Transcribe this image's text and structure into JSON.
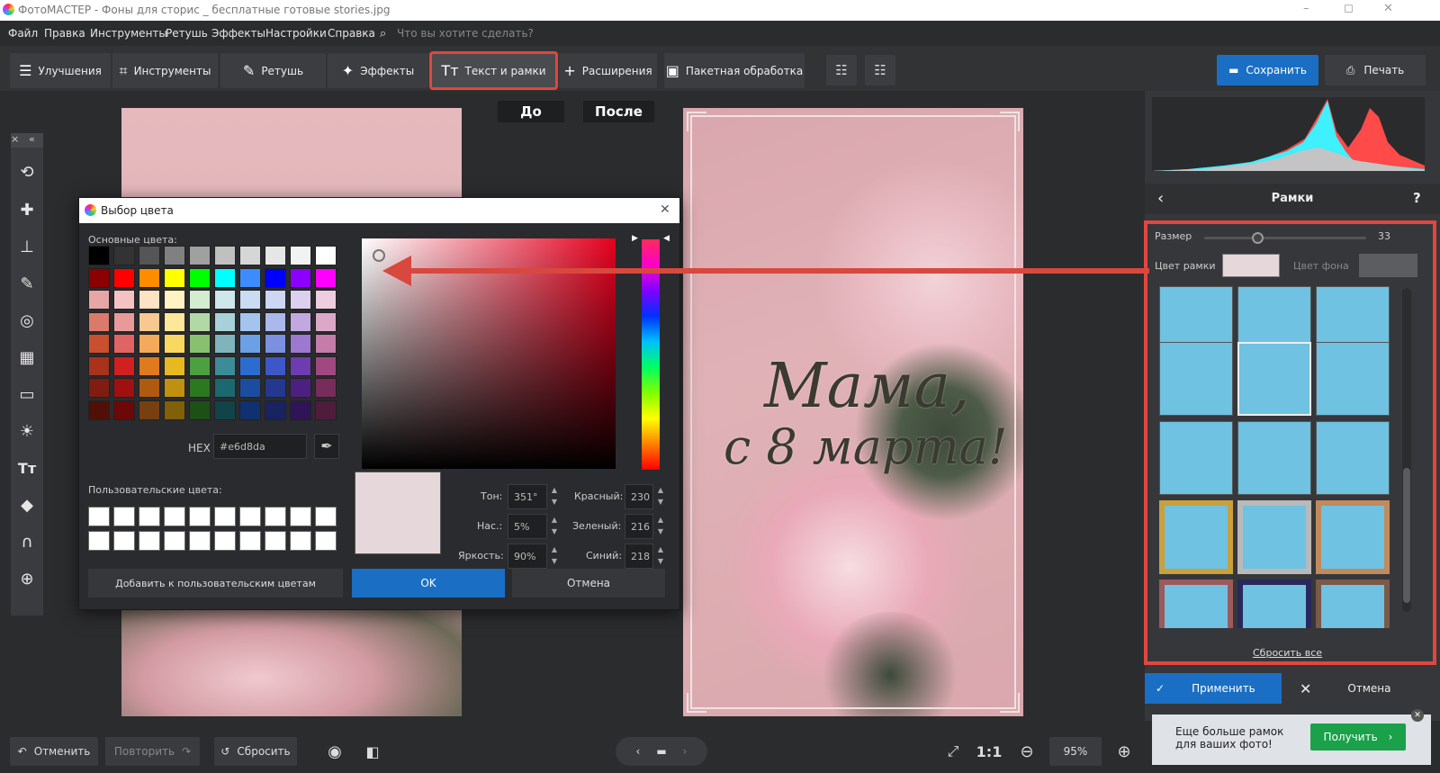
{
  "window": {
    "title": "ФотоМАСТЕР - Фоны для сторис _ бесплатные готовые stories.jpg",
    "minimize": "–",
    "maximize": "◻",
    "close": "✕"
  },
  "menu": {
    "items": [
      "Файл",
      "Правка",
      "Инструменты",
      "Ретушь",
      "Эффекты",
      "Настройки",
      "Справка"
    ],
    "search_placeholder": "Что вы хотите сделать?"
  },
  "toolbar": {
    "tabs": [
      {
        "label": "Улучшения",
        "icon": "sliders-icon"
      },
      {
        "label": "Инструменты",
        "icon": "crop-icon"
      },
      {
        "label": "Ретушь",
        "icon": "brush-icon"
      },
      {
        "label": "Эффекты",
        "icon": "sparkle-icon"
      },
      {
        "label": "Текст и рамки",
        "icon": "text-icon",
        "active": true
      },
      {
        "label": "Расширения",
        "icon": "plus-icon"
      },
      {
        "label": "Пакетная обработка",
        "icon": "images-icon"
      }
    ],
    "save_label": "Сохранить",
    "print_label": "Печать"
  },
  "canvas": {
    "before_label": "До",
    "after_label": "После",
    "greeting_line1": "Мама,",
    "greeting_line2": "с 8 марта!"
  },
  "right_panel": {
    "header_title": "Рамки",
    "help": "?",
    "size_label": "Размер",
    "size_value": "33",
    "size_fraction": 0.33,
    "frame_color_label": "Цвет рамки",
    "bg_color_label": "Цвет фона",
    "frame_color": "#e6d8da",
    "reset_all": "Сбросить все",
    "apply_label": "Применить",
    "cancel_label": "Отмена"
  },
  "promo": {
    "text": "Еще больше рамок для ваших фото!",
    "button": "Получить"
  },
  "bottom": {
    "undo": "Отменить",
    "redo": "Повторить",
    "reset": "Сбросить",
    "zoom_fit": "1:1",
    "zoom": "95%"
  },
  "dialog": {
    "title": "Выбор цвета",
    "basic_colors_label": "Основные цвета:",
    "custom_colors_label": "Пользовательские цвета:",
    "hex_label": "HEX",
    "hex_value": "#e6d8da",
    "add_custom_label": "Добавить к пользовательским цветам",
    "ok_label": "OK",
    "cancel_label": "Отмена",
    "preview_color": "#e6d8da",
    "fields": [
      {
        "label": "Тон:",
        "value": "351°"
      },
      {
        "label": "Нас.:",
        "value": "5%"
      },
      {
        "label": "Яркость:",
        "value": "90%"
      },
      {
        "label": "Красный:",
        "value": "230"
      },
      {
        "label": "Зеленый:",
        "value": "216"
      },
      {
        "label": "Синий:",
        "value": "218"
      }
    ],
    "basic_colors": [
      [
        "#000000",
        "#333333",
        "#555555",
        "#808080",
        "#a0a0a0",
        "#c0c0c0",
        "#d6d6d6",
        "#e6e6e6",
        "#f2f2f2",
        "#ffffff"
      ],
      [
        "#8b0000",
        "#ff0000",
        "#ff8c00",
        "#ffff00",
        "#00ff00",
        "#00ffff",
        "#3c8cff",
        "#0000ff",
        "#8b00ff",
        "#ff00ff"
      ],
      [
        "#e6a6a6",
        "#f4c2c2",
        "#fde2c4",
        "#fff3c4",
        "#d4ecd0",
        "#cfe6ea",
        "#c9dcf4",
        "#cdd6f2",
        "#ddd0ee",
        "#eecde0"
      ],
      [
        "#d97a6a",
        "#e89a9a",
        "#f8c890",
        "#fde79a",
        "#b2d8a6",
        "#a8d0d8",
        "#a4c4ee",
        "#aab8ea",
        "#c2a8e0",
        "#dca8c8"
      ],
      [
        "#c8502e",
        "#e06464",
        "#f4aa5a",
        "#f8d860",
        "#88c070",
        "#80b4bc",
        "#6ca0e6",
        "#7c90e0",
        "#9c78d0",
        "#c47ca8"
      ],
      [
        "#a8321a",
        "#d02020",
        "#e07a1e",
        "#e8b820",
        "#4ca040",
        "#3c8c98",
        "#2c6cd0",
        "#3c58c8",
        "#6c3cb0",
        "#a04880"
      ],
      [
        "#801c10",
        "#a01010",
        "#b05a10",
        "#c09010",
        "#2c7820",
        "#1c6870",
        "#1c4ca0",
        "#243890",
        "#4c2080",
        "#782c5c"
      ],
      [
        "#501008",
        "#6c0808",
        "#784010",
        "#806008",
        "#1c5014",
        "#104448",
        "#103070",
        "#182460",
        "#301458",
        "#501c3c"
      ]
    ]
  },
  "colors": {
    "accent": "#1a6fc4",
    "highlight": "#e0473e",
    "green": "#1aa14a",
    "frame_thumb": "#6fc2e2"
  },
  "leftbar_icons": [
    "crop-rotate-icon",
    "patch-icon",
    "stamp-icon",
    "brush-icon",
    "radial-icon",
    "gradient-icon",
    "vignette-icon",
    "light-icon",
    "text-icon",
    "fill-icon",
    "horseshoe-icon",
    "globe-icon"
  ]
}
